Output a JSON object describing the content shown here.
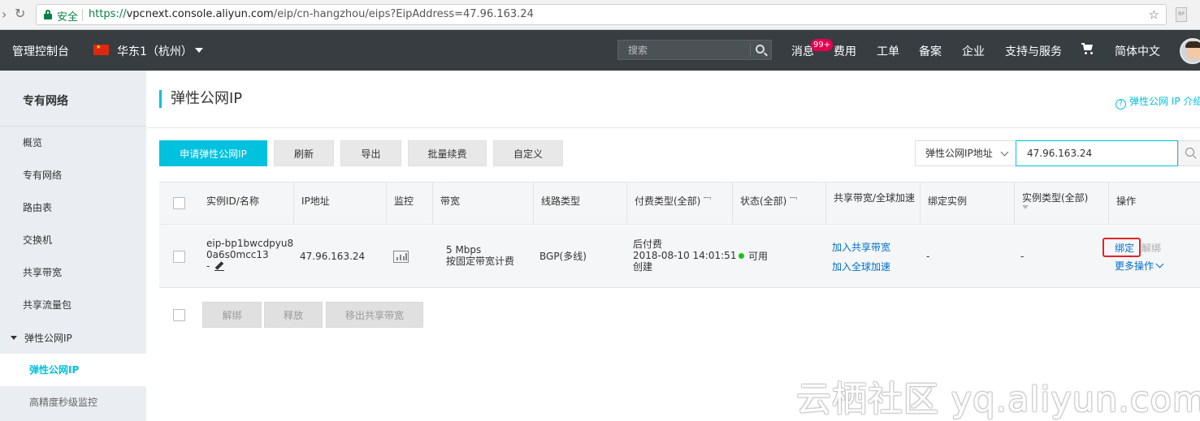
{
  "browser": {
    "secure_label": "安全",
    "url_scheme": "https://",
    "url_host": "vpcnext.console.aliyun.com",
    "url_path": "/eip/cn-hangzhou/eips?EipAddress=47.96.163.24"
  },
  "topnav": {
    "console": "管理控制台",
    "region": "华东1（杭州）",
    "search_placeholder": "搜索",
    "messages": "消息",
    "messages_badge": "99+",
    "items": [
      "费用",
      "工单",
      "备案",
      "企业",
      "支持与服务"
    ],
    "language": "简体中文"
  },
  "sidebar": {
    "title": "专有网络",
    "items": [
      "概览",
      "专有网络",
      "路由表",
      "交换机",
      "共享带宽",
      "共享流量包"
    ],
    "group": "弹性公网IP",
    "sub_items": [
      "弹性公网IP",
      "高精度秒级监控"
    ]
  },
  "main": {
    "title": "弹性公网IP",
    "help_link": "弹性公网 IP 介绍",
    "toolbar": {
      "apply": "申请弹性公网IP",
      "refresh": "刷新",
      "export": "导出",
      "batch_renew": "批量续费",
      "customize": "自定义"
    },
    "filter": {
      "field": "弹性公网IP地址",
      "value": "47.96.163.24"
    },
    "table": {
      "headers": {
        "id_name": "实例ID/名称",
        "ip": "IP地址",
        "monitor": "监控",
        "bandwidth": "带宽",
        "line_type": "线路类型",
        "billing": "付费类型(全部)",
        "status": "状态(全部)",
        "shared": "共享带宽/全球加速",
        "bound_instance": "绑定实例",
        "instance_type": "实例类型(全部)",
        "actions": "操作"
      },
      "rows": [
        {
          "id_line1": "eip-bp1bwcdpyu8",
          "id_line2": "0a6s0mcc13",
          "name": "-",
          "ip": "47.96.163.24",
          "bandwidth_value": "5 Mbps",
          "bandwidth_mode": "按固定带宽计费",
          "line_type": "BGP(多线)",
          "billing_type": "后付费",
          "created_time": "2018-08-10 14:01:51",
          "created_label": "创建",
          "status": "可用",
          "add_shared": "加入共享带宽",
          "add_global": "加入全球加速",
          "bound_instance": "-",
          "instance_type": "-",
          "bind": "绑定",
          "unbind": "解绑",
          "more": "更多操作"
        }
      ]
    },
    "bottom_actions": {
      "unbind": "解绑",
      "release": "释放",
      "remove_shared": "移出共享带宽"
    }
  },
  "watermark": "云栖社区 yq.aliyun.com",
  "colors": {
    "accent": "#00c1de",
    "topnav_bg": "#373d41",
    "link": "#0070cc",
    "status_ok": "#1dc11d",
    "highlight": "#e0232a"
  }
}
